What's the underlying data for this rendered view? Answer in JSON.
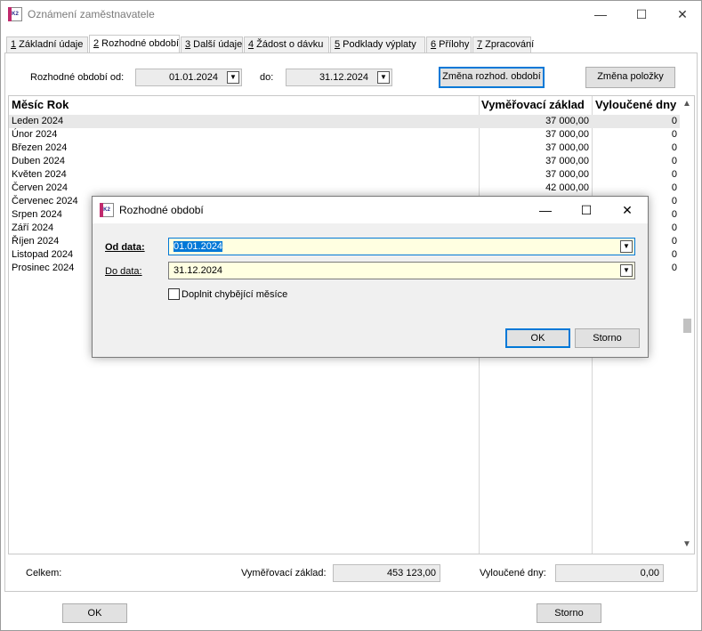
{
  "window": {
    "title": "Oznámení zaměstnavatele",
    "minimize": "—",
    "maximize": "☐",
    "close": "✕"
  },
  "tabs": [
    {
      "num": "1",
      "label": " Základní údaje"
    },
    {
      "num": "2",
      "label": " Rozhodné období"
    },
    {
      "num": "3",
      "label": " Další údaje"
    },
    {
      "num": "4",
      "label": " Žádost o dávku"
    },
    {
      "num": "5",
      "label": " Podklady výplaty"
    },
    {
      "num": "6",
      "label": " Přílohy"
    },
    {
      "num": "7",
      "label": " Zpracování"
    }
  ],
  "filter": {
    "from_label": "Rozhodné období od:",
    "from_value": "01.01.2024",
    "to_label": "do:",
    "to_value": "31.12.2024",
    "change_period_button": "Změna rozhod. období",
    "change_item_button": "Změna položky"
  },
  "table": {
    "columns": [
      "Měsíc Rok",
      "Vyměřovací základ",
      "Vyloučené dny"
    ],
    "rows": [
      {
        "month": "Leden 2024",
        "base": "37 000,00",
        "days": "0"
      },
      {
        "month": "Únor 2024",
        "base": "37 000,00",
        "days": "0"
      },
      {
        "month": "Březen 2024",
        "base": "37 000,00",
        "days": "0"
      },
      {
        "month": "Duben 2024",
        "base": "37 000,00",
        "days": "0"
      },
      {
        "month": "Květen 2024",
        "base": "37 000,00",
        "days": "0"
      },
      {
        "month": "Červen 2024",
        "base": "42 000,00",
        "days": "0"
      },
      {
        "month": "Červenec 2024",
        "base": "",
        "days": "0"
      },
      {
        "month": "Srpen 2024",
        "base": "",
        "days": "0"
      },
      {
        "month": "Září 2024",
        "base": "",
        "days": "0"
      },
      {
        "month": "Říjen 2024",
        "base": "",
        "days": "0"
      },
      {
        "month": "Listopad 2024",
        "base": "",
        "days": "0"
      },
      {
        "month": "Prosinec 2024",
        "base": "",
        "days": "0"
      }
    ]
  },
  "totals": {
    "label": "Celkem:",
    "base_label": "Vyměřovací základ:",
    "base_value": "453 123,00",
    "days_label": "Vyloučené dny:",
    "days_value": "0,00"
  },
  "footer": {
    "ok_button": "OK",
    "cancel_button": "Storno"
  },
  "dialog": {
    "title": "Rozhodné období",
    "from_label": "Od data:",
    "from_value": "01.01.2024",
    "to_label": "Do data:",
    "to_value": "31.12.2024",
    "checkbox_label": "Doplnit chybějící měsíce",
    "checkbox_checked": false,
    "ok_button": "OK",
    "cancel_button": "Storno"
  },
  "icons": {
    "app": "K2",
    "dropdown": "▼",
    "scroll_up": "▲",
    "scroll_down": "▼"
  }
}
